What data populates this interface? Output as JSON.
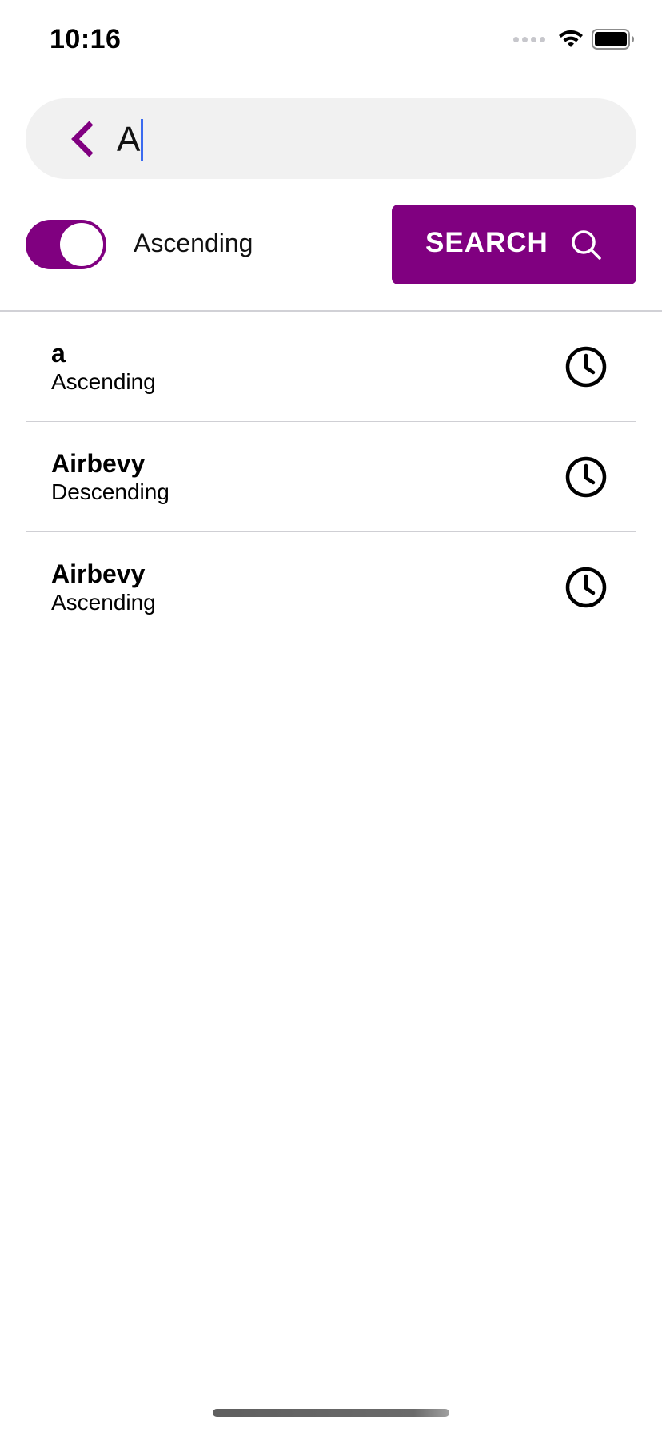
{
  "status_bar": {
    "time": "10:16"
  },
  "search": {
    "query": "A",
    "back_icon": "chevron-left-icon"
  },
  "sort": {
    "enabled": true,
    "label": "Ascending"
  },
  "search_button": {
    "label": "SEARCH",
    "icon": "magnifier-icon"
  },
  "history": [
    {
      "title": "a",
      "subtitle": "Ascending",
      "icon": "clock-icon"
    },
    {
      "title": "Airbevy",
      "subtitle": "Descending",
      "icon": "clock-icon"
    },
    {
      "title": "Airbevy",
      "subtitle": "Ascending",
      "icon": "clock-icon"
    }
  ],
  "colors": {
    "accent": "#800080",
    "search_bar_bg": "#f1f1f1",
    "caret": "#3b6bf0"
  }
}
